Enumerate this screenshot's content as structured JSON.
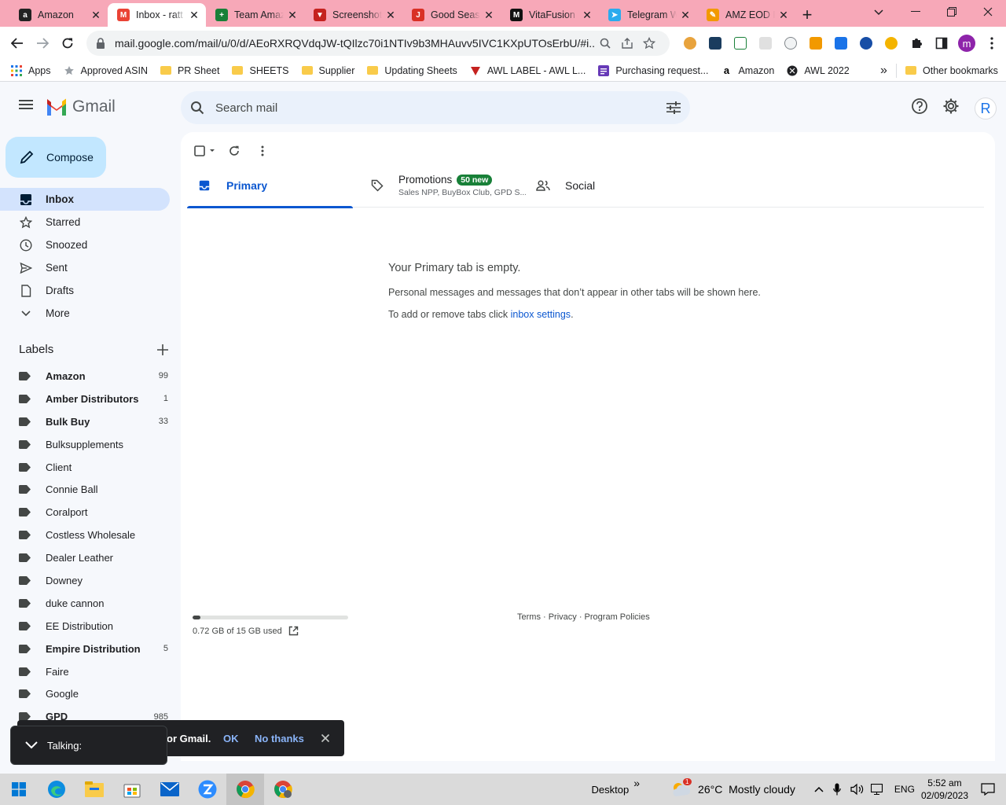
{
  "browser": {
    "tabs": [
      {
        "title": "Amazon",
        "fav_color": "#222222",
        "fav_glyph": "a"
      },
      {
        "title": "Inbox - ratt",
        "fav_color": "#ea4335",
        "fav_glyph": "M"
      },
      {
        "title": "Team Amaz",
        "fav_color": "#188038",
        "fav_glyph": "+"
      },
      {
        "title": "Screenshot",
        "fav_color": "#c5221f",
        "fav_glyph": "▼"
      },
      {
        "title": "Good Seas",
        "fav_color": "#d93025",
        "fav_glyph": "J"
      },
      {
        "title": "VitaFusion",
        "fav_color": "#111111",
        "fav_glyph": "M"
      },
      {
        "title": "Telegram W",
        "fav_color": "#2aabee",
        "fav_glyph": "➤"
      },
      {
        "title": "AMZ EOD F",
        "fav_color": "#f29900",
        "fav_glyph": "✎"
      }
    ],
    "url": "mail.google.com/mail/u/0/d/AEoRXRQVdqJW-tQIlzc70i1NTIv9b3MHAuvv5IVC1KXpUTOsErbU/#i...",
    "profile_initial": "m",
    "bookmarks": [
      {
        "label": "Apps",
        "icon": "apps-grid-icon"
      },
      {
        "label": "Approved ASIN",
        "icon": "star-icon"
      },
      {
        "label": "PR Sheet",
        "icon": "folder-icon"
      },
      {
        "label": "SHEETS",
        "icon": "folder-icon"
      },
      {
        "label": "Supplier",
        "icon": "folder-icon"
      },
      {
        "label": "Updating Sheets",
        "icon": "folder-icon"
      },
      {
        "label": "AWL LABEL - AWL L...",
        "icon": "awl-icon"
      },
      {
        "label": "Purchasing request...",
        "icon": "form-icon"
      },
      {
        "label": "Amazon",
        "icon": "amazon-icon"
      },
      {
        "label": "AWL 2022",
        "icon": "globe-icon"
      }
    ],
    "other_bookmarks": "Other bookmarks",
    "more_bookmarks": "»"
  },
  "gmail": {
    "logo_text": "Gmail",
    "search_placeholder": "Search mail",
    "avatar_initial": "R",
    "compose_label": "Compose",
    "nav": [
      {
        "label": "Inbox",
        "icon": "inbox-icon",
        "active": true
      },
      {
        "label": "Starred",
        "icon": "star-icon"
      },
      {
        "label": "Snoozed",
        "icon": "clock-icon"
      },
      {
        "label": "Sent",
        "icon": "send-icon"
      },
      {
        "label": "Drafts",
        "icon": "draft-icon"
      },
      {
        "label": "More",
        "icon": "chevron-down-icon"
      }
    ],
    "labels_title": "Labels",
    "labels": [
      {
        "name": "Amazon",
        "count": "99",
        "bold": true
      },
      {
        "name": "Amber Distributors",
        "count": "1",
        "bold": true
      },
      {
        "name": "Bulk Buy",
        "count": "33",
        "bold": true
      },
      {
        "name": "Bulksupplements",
        "count": ""
      },
      {
        "name": "Client",
        "count": ""
      },
      {
        "name": "Connie Ball",
        "count": ""
      },
      {
        "name": "Coralport",
        "count": ""
      },
      {
        "name": "Costless Wholesale",
        "count": ""
      },
      {
        "name": "Dealer Leather",
        "count": ""
      },
      {
        "name": "Downey",
        "count": ""
      },
      {
        "name": "duke cannon",
        "count": ""
      },
      {
        "name": "EE Distribution",
        "count": ""
      },
      {
        "name": "Empire Distribution",
        "count": "5",
        "bold": true
      },
      {
        "name": "Faire",
        "count": ""
      },
      {
        "name": "Google",
        "count": ""
      },
      {
        "name": "GPD",
        "count": "985",
        "bold": true
      }
    ],
    "tabs": {
      "primary": "Primary",
      "promotions": "Promotions",
      "promotions_badge": "50 new",
      "promotions_sub": "Sales NPP, BuyBox Club, GPD S...",
      "social": "Social"
    },
    "empty": {
      "heading": "Your Primary tab is empty.",
      "line1": "Personal messages and messages that don’t appear in other tabs will be shown here.",
      "line2_prefix": "To add or remove tabs click ",
      "line2_link": "inbox settings",
      "line2_suffix": "."
    },
    "storage": {
      "text": "0.72 GB of 15 GB used",
      "fraction": 0.048
    },
    "footer": "Terms · Privacy · Program Policies",
    "snackbar": {
      "text": "or Gmail.",
      "ok": "OK",
      "no_thanks": "No thanks"
    },
    "talk_label": "Talking:"
  },
  "taskbar": {
    "desktop": "Desktop",
    "chevron": "»",
    "weather": "26°C  Mostly cloudy",
    "weather_badge": "1",
    "lang": "ENG",
    "time": "5:52 am",
    "date": "02/09/2023"
  }
}
